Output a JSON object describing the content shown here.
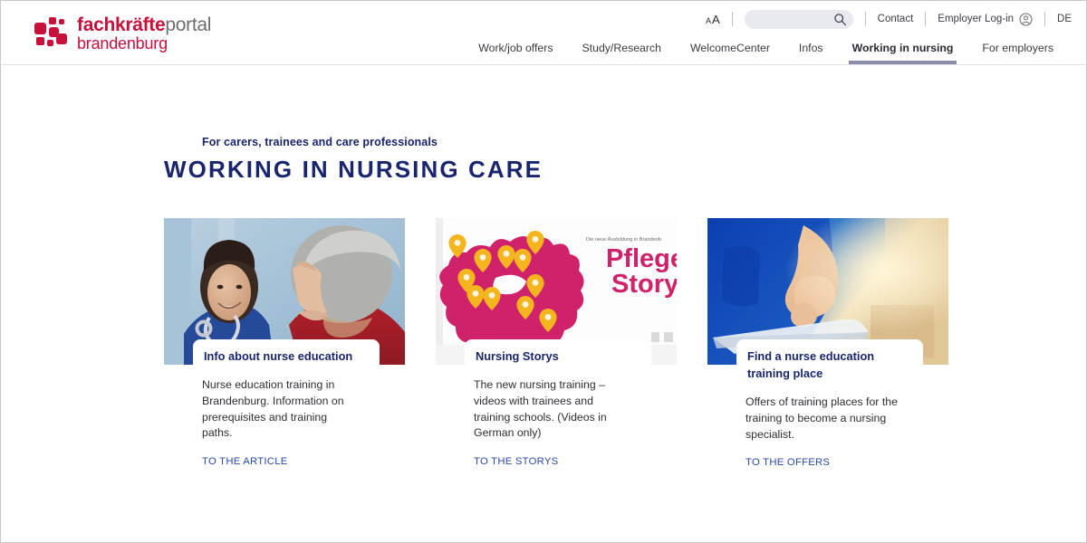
{
  "header": {
    "logo": {
      "line1_bold": "fachkräfte",
      "line1_light": "portal",
      "line2": "brandenburg",
      "mark_name": "fachkraefteportal-logo-mark"
    },
    "utility": {
      "font_size_small": "A",
      "font_size_large": "A",
      "search_value": "",
      "search_placeholder": "",
      "contact": "Contact",
      "employer_login": "Employer Log-in",
      "language": "DE"
    },
    "nav": [
      {
        "label": "Work/job offers",
        "active": false
      },
      {
        "label": "Study/Research",
        "active": false
      },
      {
        "label": "WelcomeCenter",
        "active": false
      },
      {
        "label": "Infos",
        "active": false
      },
      {
        "label": "Working in nursing",
        "active": true
      },
      {
        "label": "For employers",
        "active": false
      }
    ]
  },
  "main": {
    "kicker": "For carers, trainees and care professionals",
    "title": "WORKING IN NURSING CARE",
    "cards": [
      {
        "title": "Info about nurse education",
        "description": "Nurse education training in Brandenburg. Information on prerequisites and training paths.",
        "cta": "TO THE ARTICLE",
        "image_name": "nurse-with-patient-photo"
      },
      {
        "title": "Nursing Storys",
        "description": "The new nursing training – videos with trainees and training schools. (Videos in German only)",
        "cta": "TO THE STORYS",
        "image_name": "pflege-storys-map-graphic",
        "image_text": {
          "overline": "Die neue Ausbildung in Brandenb",
          "line1": "Pflege",
          "line2": "Storys"
        }
      },
      {
        "title": "Find a nurse education training place",
        "description": "Offers of training places for the training to become a nursing specialist.",
        "cta": "TO THE OFFERS",
        "image_name": "nurse-using-tablet-photo"
      }
    ]
  },
  "colors": {
    "brand_red": "#c8103c",
    "brand_navy": "#19256e",
    "link_blue": "#2b49a8",
    "nav_active_underline": "#8c8cab",
    "magenta": "#d0216b",
    "pin_yellow": "#f5b51e"
  }
}
